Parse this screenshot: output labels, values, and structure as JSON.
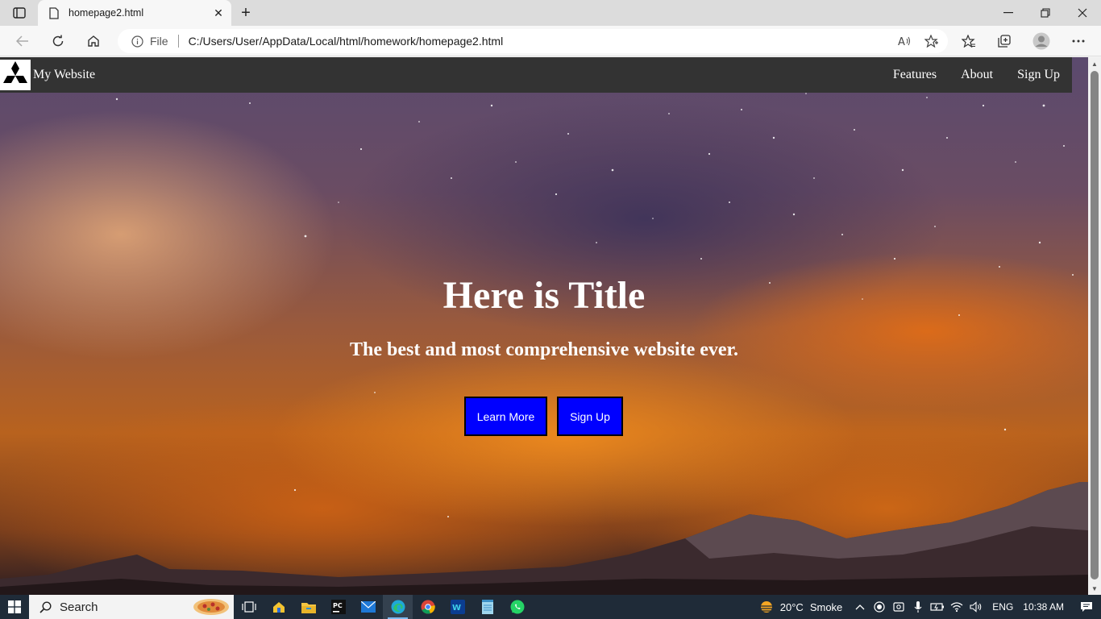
{
  "browser": {
    "tab": {
      "title": "homepage2.html",
      "close": "✕"
    },
    "new_tab": "+",
    "address": {
      "scheme_label": "File",
      "url": "C:/Users/User/AppData/Local/html/homework/homepage2.html"
    }
  },
  "page": {
    "nav": {
      "site_name": "My Website",
      "links": [
        "Features",
        "About",
        "Sign Up"
      ]
    },
    "hero": {
      "title": "Here is Title",
      "subtitle": "The best and most comprehensive website ever.",
      "buttons": [
        "Learn More",
        "Sign Up"
      ]
    },
    "colors": {
      "navbar": "#333333",
      "button": "#0000ff"
    }
  },
  "taskbar": {
    "search_placeholder": "Search",
    "weather": {
      "temp": "20°C",
      "condition": "Smoke"
    },
    "language": "ENG",
    "time": "10:38 AM"
  }
}
